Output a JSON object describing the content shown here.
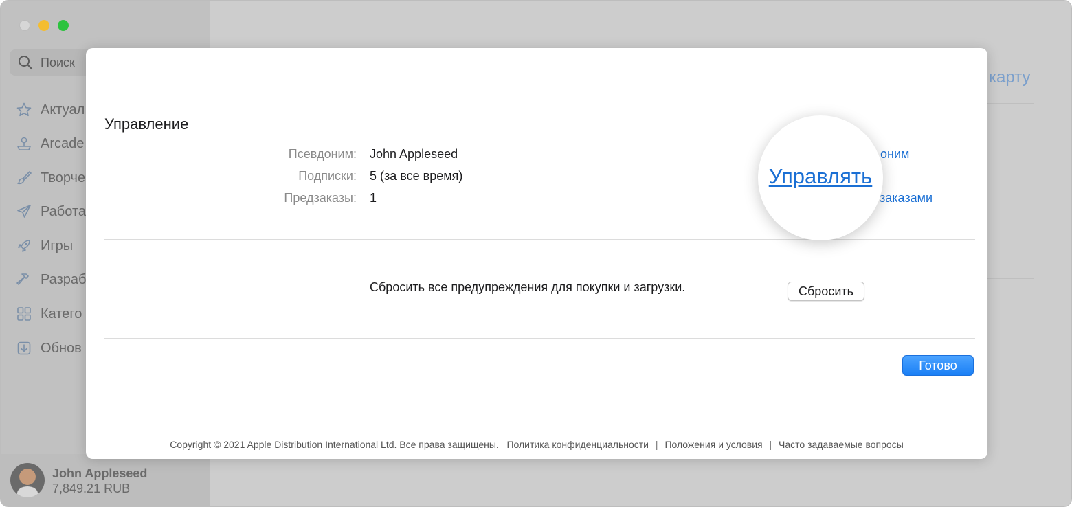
{
  "sidebar": {
    "search_placeholder": "Поиск",
    "items": [
      {
        "label": "Актуал",
        "icon": "star-icon"
      },
      {
        "label": "Arcade",
        "icon": "joystick-icon"
      },
      {
        "label": "Творче",
        "icon": "brush-icon"
      },
      {
        "label": "Работа",
        "icon": "paper-plane-icon"
      },
      {
        "label": "Игры",
        "icon": "rocket-icon"
      },
      {
        "label": "Разраб",
        "icon": "hammer-icon"
      },
      {
        "label": "Катего",
        "icon": "grid-icon"
      },
      {
        "label": "Обнов",
        "icon": "download-icon"
      }
    ],
    "user": {
      "name": "John Appleseed",
      "balance": "7,849.21 RUB"
    }
  },
  "background": {
    "link_fragment": "карту"
  },
  "modal": {
    "section_title": "Управление",
    "rows": [
      {
        "label": "Псевдоним:",
        "value": "John Appleseed",
        "link": "оним"
      },
      {
        "label": "Подписки:",
        "value": "5 (за все время)",
        "link": "Управлять"
      },
      {
        "label": "Предзаказы:",
        "value": "1",
        "link": "заказами"
      }
    ],
    "magnified_link": "Управлять",
    "reset_text": "Сбросить все предупреждения для покупки и загрузки.",
    "reset_button": "Сбросить",
    "done_button": "Готово",
    "footer": {
      "copyright": "Copyright © 2021 Apple Distribution International Ltd. Все права защищены.",
      "privacy": "Политика конфиденциальности",
      "terms": "Положения и условия",
      "faq": "Часто задаваемые вопросы",
      "separator": "|"
    }
  },
  "colors": {
    "link": "#1a6fd4",
    "primary_button": "#1a7ff5"
  }
}
